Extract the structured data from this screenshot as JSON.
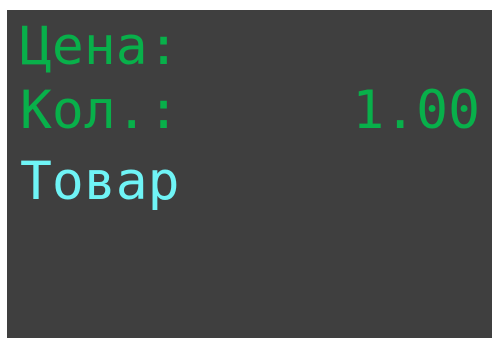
{
  "display": {
    "price_label": "Цена:",
    "quantity_label": "Кол.:",
    "quantity_value": "1.00",
    "item_label": "Товар"
  },
  "colors": {
    "background": "#3f3f3f",
    "green_text": "#08b04a",
    "cyan_text": "#6ff4f6"
  }
}
